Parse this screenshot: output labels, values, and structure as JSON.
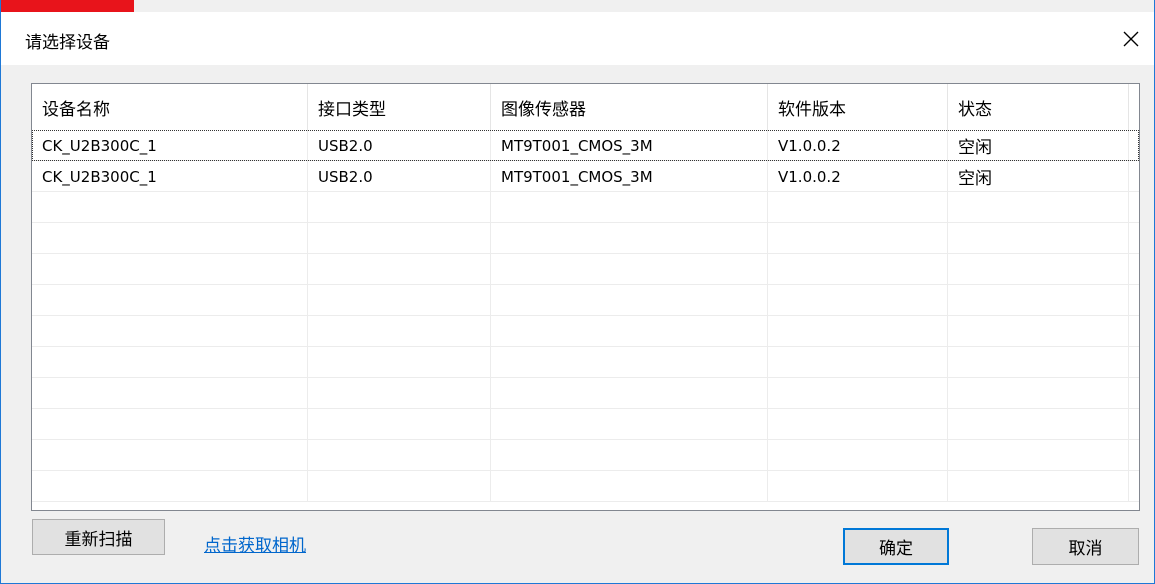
{
  "window": {
    "title": "请选择设备",
    "close_icon": "close-icon"
  },
  "listview": {
    "columns": [
      "设备名称",
      "接口类型",
      "图像传感器",
      "软件版本",
      "状态"
    ],
    "rows": [
      [
        "CK_U2B300C_1",
        "USB2.0",
        "MT9T001_CMOS_3M",
        "V1.0.0.2",
        "空闲"
      ],
      [
        "CK_U2B300C_1",
        "USB2.0",
        "MT9T001_CMOS_3M",
        "V1.0.0.2",
        "空闲"
      ]
    ]
  },
  "footer": {
    "rescan_label": "重新扫描",
    "get_camera_link": "点击获取相机",
    "ok_label": "确定",
    "cancel_label": "取消"
  },
  "colors": {
    "accent": "#0078d7",
    "badge": "#e8141b",
    "link": "#0066cc"
  }
}
